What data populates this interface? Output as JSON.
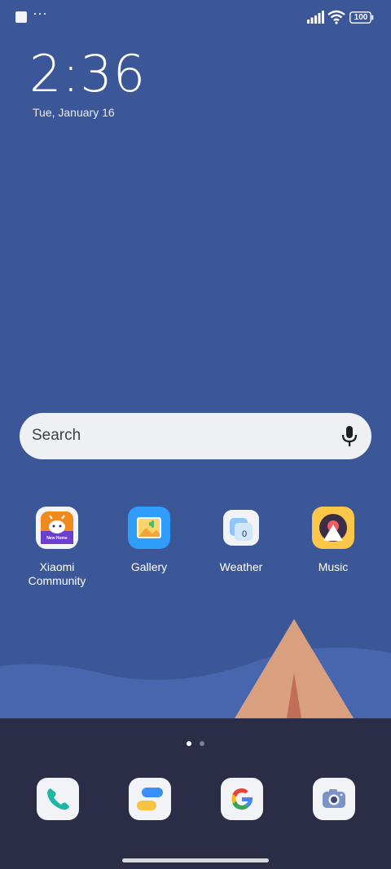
{
  "status_bar": {
    "overflow_dots": "···",
    "battery": "100"
  },
  "lockscreen": {
    "time": "2:36",
    "date": "Tue, January 16"
  },
  "search": {
    "placeholder": "Search"
  },
  "apps": [
    {
      "label": "Xiaomi\nCommunity",
      "icon": "xiaomi-community-icon"
    },
    {
      "label": "Gallery",
      "icon": "gallery-icon"
    },
    {
      "label": "Weather",
      "icon": "weather-icon",
      "badge": "0"
    },
    {
      "label": "Music",
      "icon": "music-icon"
    }
  ],
  "xiaomi_badge_text": "New Home",
  "dock": {
    "apps": [
      {
        "name": "phone",
        "icon": "phone-icon"
      },
      {
        "name": "messaging",
        "icon": "messaging-icon"
      },
      {
        "name": "google",
        "icon": "google-icon"
      },
      {
        "name": "camera",
        "icon": "camera-icon"
      }
    ],
    "page_count": 2,
    "active_page": 1
  },
  "colors": {
    "wallpaper": "#3b5797",
    "dock_bg": "#2a2d45",
    "search_bg": "#eef0f4"
  }
}
